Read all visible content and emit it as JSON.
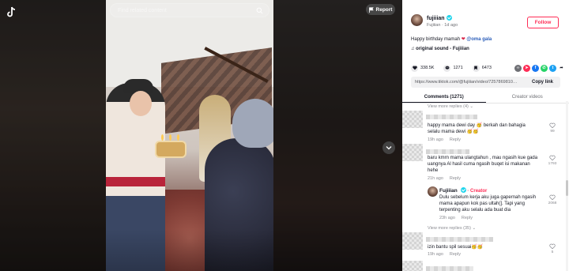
{
  "search": {
    "placeholder": "Find related content"
  },
  "report": {
    "label": "Report"
  },
  "author": {
    "name": "fujiiian",
    "sub": "Fujiiian · 1d ago"
  },
  "follow": {
    "label": "Follow"
  },
  "caption": {
    "text": "Happy birthday mamah",
    "heart": "❤",
    "mention": "@oma gala"
  },
  "sound": {
    "label": "original sound - Fujiiian"
  },
  "stats": {
    "likes": "338.5K",
    "comments": "1271",
    "saves": "6473"
  },
  "link": {
    "url": "https://www.tiktok.com/@fujiiian/video/7257869810…",
    "copy": "Copy link"
  },
  "tabs": [
    {
      "label": "Comments (1271)"
    },
    {
      "label": "Creator videos"
    }
  ],
  "comments": {
    "view_more_top": "View more replies (4) ⌄",
    "c1": {
      "text": "happy mama dewi day 🥳 berkah dan bahagia selalu mama dewi 🥳🥳",
      "date": "19h ago",
      "reply": "Reply",
      "likes": "99"
    },
    "c2": {
      "text": "baru kmrn mama ulangtahun , mau ngasih kue gada uangnya Al hasil cuma ngasih buqet isi makanan hehe",
      "date": "21h ago",
      "reply": "Reply",
      "likes": "1793"
    },
    "reply": {
      "name": "Fujiiian",
      "tag": "· Creator",
      "text": "Dulu sebelum kerja aku juga gapernah ngasih mama apapun kok pas ultah(]. Tapi yang terpenting aku selalu ada buat dia",
      "date": "23h ago",
      "reply": "Reply",
      "likes": "2068"
    },
    "view_more_mid": "View more replies (35) ⌄",
    "c3": {
      "text": "izin bantu spil sesuai🥳🥳",
      "date": "19h ago",
      "reply": "Reply",
      "likes": "5"
    }
  },
  "colors": {
    "accent": "#fe2c55",
    "verified": "#20d5ec",
    "mention": "#2b5db9"
  }
}
